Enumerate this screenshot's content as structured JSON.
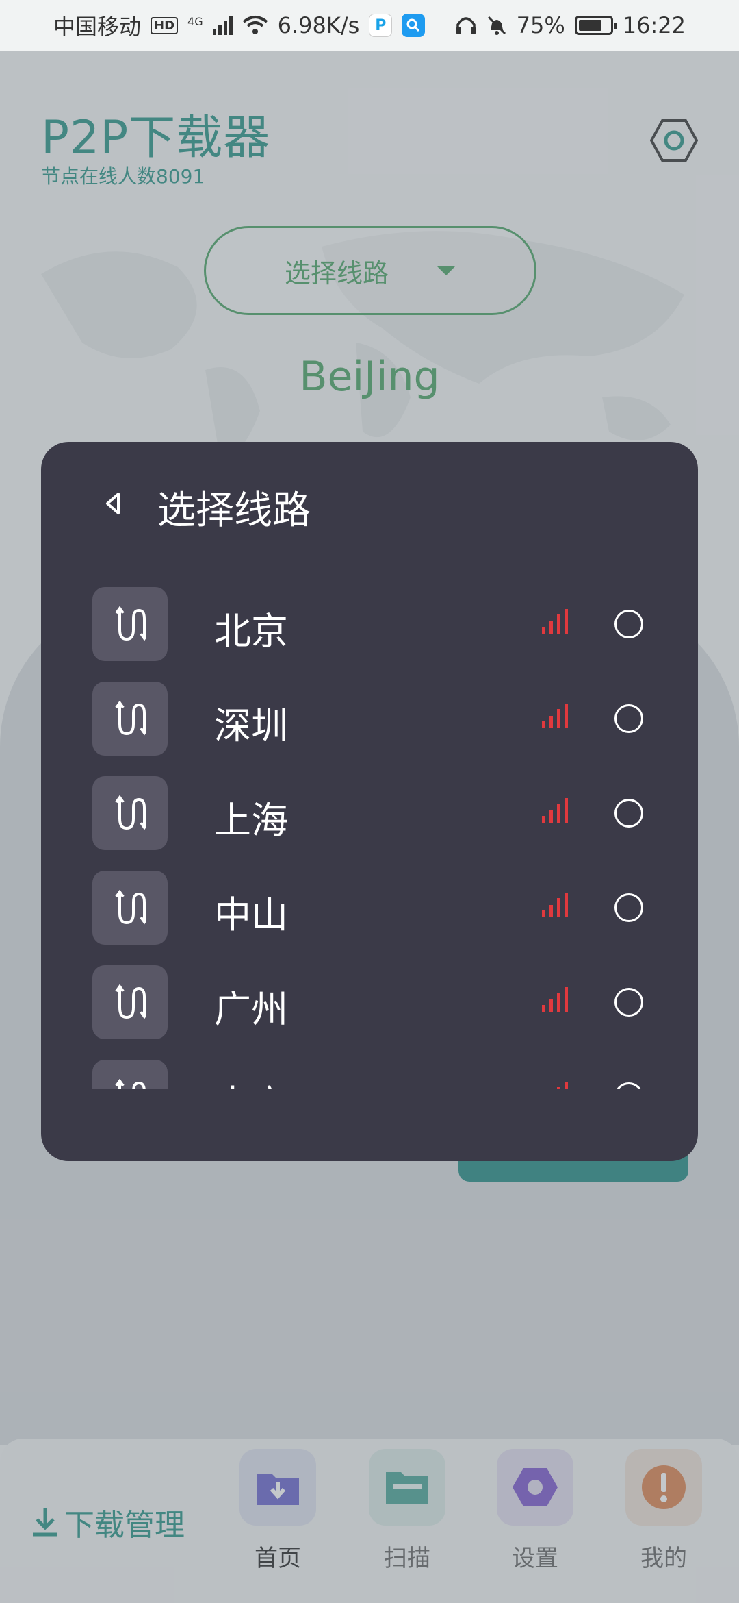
{
  "status_bar": {
    "carrier": "中国移动",
    "hd": "HD",
    "network": "4G",
    "speed": "6.98K/s",
    "battery": "75%",
    "time": "16:22"
  },
  "header": {
    "title": "P2P下载器",
    "online_text": "节点在线人数8091"
  },
  "route_button": {
    "label": "选择线路"
  },
  "current_city": "BeiJing",
  "dialog": {
    "title": "选择线路",
    "routes": [
      {
        "name": "北京"
      },
      {
        "name": "深圳"
      },
      {
        "name": "上海"
      },
      {
        "name": "中山"
      },
      {
        "name": "广州"
      },
      {
        "name": "南宁"
      }
    ]
  },
  "bottom_nav": {
    "download_manage": "下载管理",
    "items": [
      {
        "label": "首页",
        "icon": "folder-download-icon"
      },
      {
        "label": "扫描",
        "icon": "folder-icon"
      },
      {
        "label": "设置",
        "icon": "hexagon-icon"
      },
      {
        "label": "我的",
        "icon": "exclamation-icon"
      }
    ]
  },
  "colors": {
    "accent": "#14897b",
    "green": "#3a9a57",
    "dialog_bg": "#3b3a48",
    "signal_red": "#e0393e"
  }
}
